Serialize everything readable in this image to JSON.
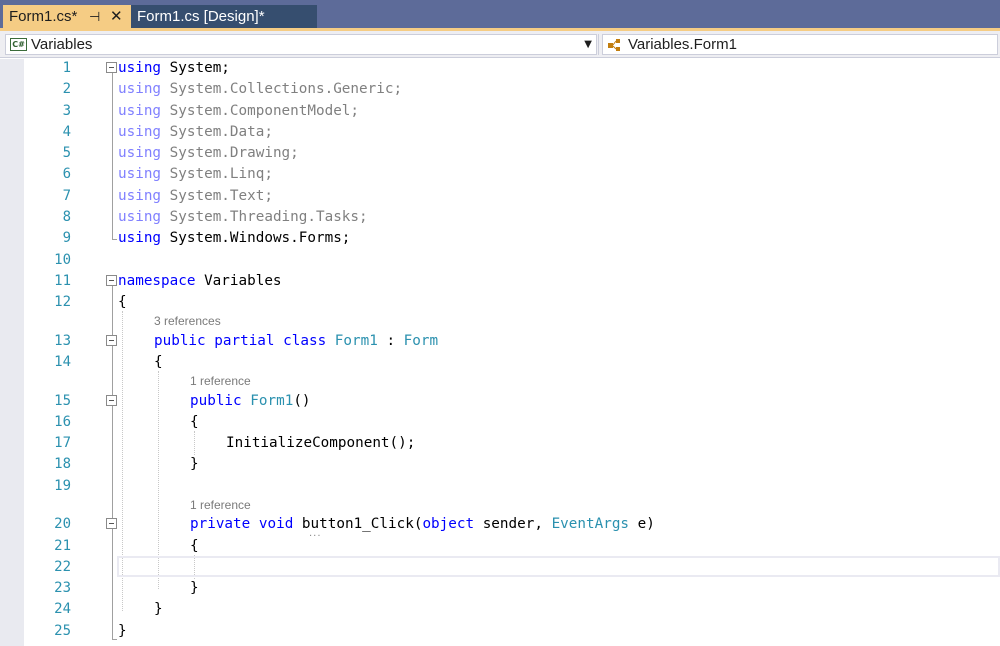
{
  "tabs": [
    {
      "label": "Form1.cs*",
      "pin": "⊣",
      "close": "✕"
    },
    {
      "label": "Form1.cs [Design]*"
    }
  ],
  "navbar": {
    "project_icon": "C#",
    "project": "Variables",
    "member": "Variables.Form1"
  },
  "editor": {
    "line_numbers": [
      "1",
      "2",
      "3",
      "4",
      "5",
      "6",
      "7",
      "8",
      "9",
      "10",
      "11",
      "12",
      "13",
      "14",
      "15",
      "16",
      "17",
      "18",
      "19",
      "20",
      "21",
      "22",
      "23",
      "24",
      "25"
    ],
    "code": {
      "l1_kw": "using",
      "l1_rest": " System;",
      "l2": "using",
      "l2_rest": " System.Collections.Generic;",
      "l3": "using",
      "l3_rest": " System.ComponentModel;",
      "l4": "using",
      "l4_rest": " System.Data;",
      "l5": "using",
      "l5_rest": " System.Drawing;",
      "l6": "using",
      "l6_rest": " System.Linq;",
      "l7": "using",
      "l7_rest": " System.Text;",
      "l8": "using",
      "l8_rest": " System.Threading.Tasks;",
      "l9_kw": "using",
      "l9_rest": " System.Windows.Forms;",
      "l11_kw": "namespace",
      "l11_rest": " Variables",
      "l12": "{",
      "l13_kw1": "public",
      "l13_kw2": "partial",
      "l13_kw3": "class",
      "l13_type1": "Form1",
      "l13_colon": " : ",
      "l13_type2": "Form",
      "l14": "{",
      "l15_kw": "public",
      "l15_type": "Form1",
      "l15_rest": "()",
      "l16": "{",
      "l17": "InitializeComponent();",
      "l18": "}",
      "l20_kw1": "private",
      "l20_kw2": "void",
      "l20_name": "button1_Click(",
      "l20_kw3": "object",
      "l20_mid": " sender, ",
      "l20_type": "EventArgs",
      "l20_end": " e)",
      "l21": "{",
      "l23": "}",
      "l24": "}",
      "l25": "}"
    },
    "codelens": {
      "class_refs": "3 references",
      "ctor_refs": "1 reference",
      "click_refs": "1 reference"
    },
    "squiggle": "···"
  }
}
